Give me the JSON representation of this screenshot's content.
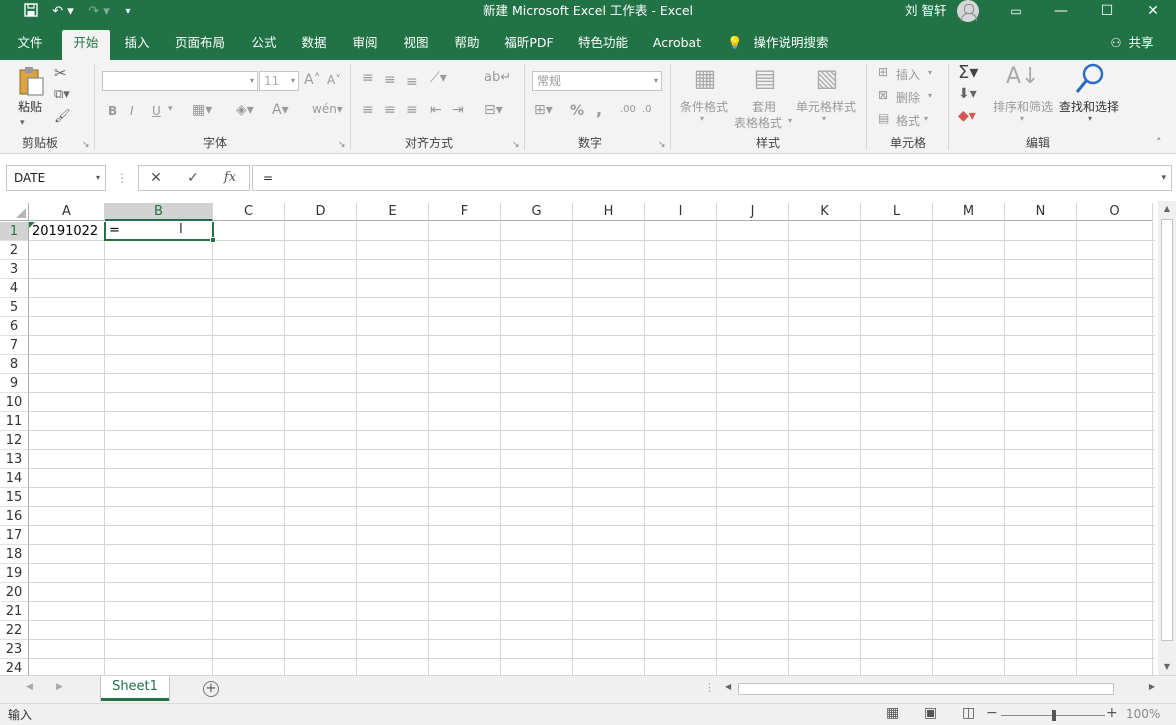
{
  "app": {
    "title": "新建 Microsoft Excel 工作表  -  Excel",
    "user": "刘 智轩"
  },
  "tabs": [
    "文件",
    "开始",
    "插入",
    "页面布局",
    "公式",
    "数据",
    "审阅",
    "视图",
    "帮助",
    "福昕PDF",
    "特色功能",
    "Acrobat",
    "操作说明搜索"
  ],
  "share_label": "共享",
  "ribbon": {
    "clipboard": {
      "label": "剪贴板",
      "paste": "粘贴"
    },
    "font": {
      "label": "字体",
      "font_size": "11",
      "bold": "B",
      "italic": "I",
      "underline": "U"
    },
    "alignment": {
      "label": "对齐方式"
    },
    "number": {
      "label": "数字",
      "format": "常规",
      "percent": "%",
      "comma": ","
    },
    "styles": {
      "label": "样式",
      "conditional": "条件格式",
      "table_format_1": "套用",
      "table_format_2": "表格格式",
      "cell_styles": "单元格样式"
    },
    "cells": {
      "label": "单元格",
      "insert": "插入",
      "delete": "删除",
      "format": "格式"
    },
    "editing": {
      "label": "编辑",
      "sort_filter": "排序和筛选",
      "find_select": "查找和选择"
    }
  },
  "formula_bar": {
    "name_box": "DATE",
    "fx": "fx",
    "formula": "="
  },
  "grid": {
    "columns": [
      "A",
      "B",
      "C",
      "D",
      "E",
      "F",
      "G",
      "H",
      "I",
      "J",
      "K",
      "L",
      "M",
      "N",
      "O"
    ],
    "rows": [
      "1",
      "2",
      "3",
      "4",
      "5",
      "6",
      "7",
      "8",
      "9",
      "10",
      "11",
      "12",
      "13",
      "14",
      "15",
      "16",
      "17",
      "18",
      "19",
      "20",
      "21",
      "22",
      "23",
      "24"
    ],
    "cells": {
      "A1": "20191022",
      "B1": "="
    }
  },
  "sheets": [
    "Sheet1"
  ],
  "status": {
    "mode": "输入",
    "zoom": "100%"
  },
  "colors": {
    "accent": "#217346",
    "ribbon_bg": "#f3f3f3",
    "grid_line": "#d4d4d4"
  }
}
